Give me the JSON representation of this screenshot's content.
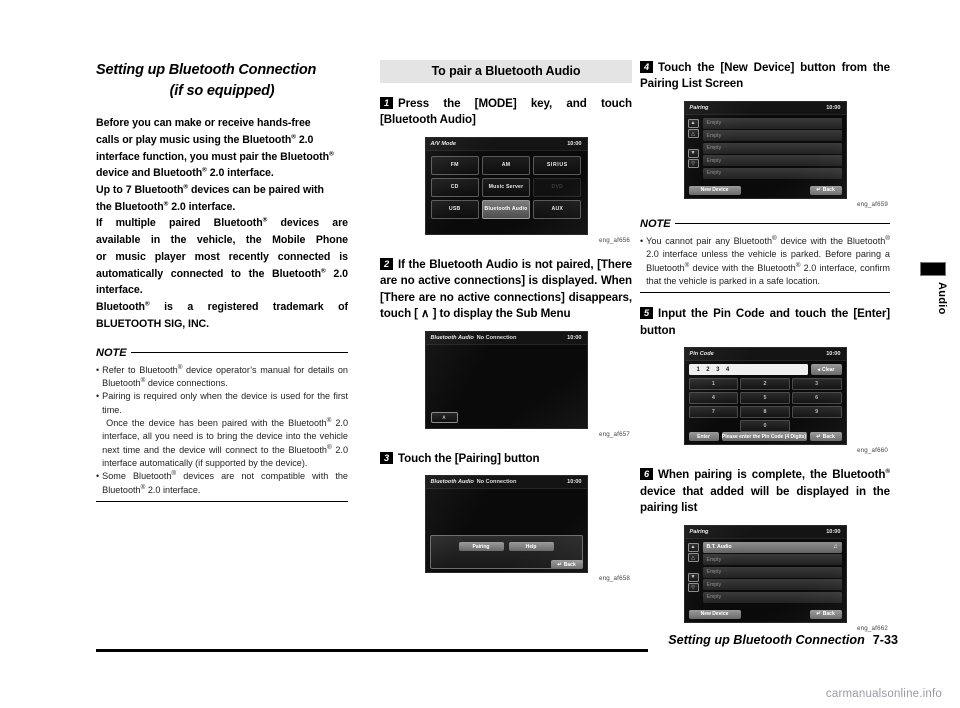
{
  "chapter": {
    "title_line1": "Setting up Bluetooth Connection",
    "title_line2": "(if so equipped)"
  },
  "intro": {
    "lines": [
      "Before you can make or receive hands-free",
      "calls or play music using the Bluetooth® 2.0",
      "interface function, you must pair the Bluetooth®",
      "device and Bluetooth® 2.0 interface.",
      "Up to 7 Bluetooth® devices can be paired with",
      "the Bluetooth® 2.0 interface.",
      "If multiple paired Bluetooth® devices are",
      "available in the vehicle, the Mobile Phone",
      "or music player most recently connected is",
      "automatically connected to the Bluetooth® 2.0",
      "interface.",
      "Bluetooth® is a registered trademark of",
      "BLUETOOTH SIG, INC."
    ]
  },
  "note_left": {
    "label": "NOTE",
    "items": [
      {
        "text": "Refer to Bluetooth® device operator’s manual for details on Bluetooth® device connections.",
        "sub": ""
      },
      {
        "text": "Pairing is required only when the device is used for the first time.",
        "sub": "Once the device has been paired with the Bluetooth® 2.0 interface, all you need is to bring the device into the vehicle next time and the device will connect to the Bluetooth® 2.0 interface automatically (if supported by the device)."
      },
      {
        "text": "Some Bluetooth® devices are not compatible with the Bluetooth® 2.0 interface.",
        "sub": ""
      }
    ]
  },
  "section_band": {
    "title": "To pair a Bluetooth Audio"
  },
  "steps": {
    "s1": {
      "num": "1",
      "text": "Press the [MODE] key, and touch [Bluetooth Audio]",
      "caption": "eng_af656"
    },
    "s2": {
      "num": "2",
      "text": "If the Bluetooth Audio is not paired, [There are no active connections] is displayed. When [There are no active connections] disappears, touch [ ∧ ] to display the Sub Menu",
      "caption": "eng_af657"
    },
    "s3": {
      "num": "3",
      "text": "Touch the [Pairing] button",
      "caption": "eng_af658"
    },
    "s4": {
      "num": "4",
      "text": "Touch the [New Device] button from the Pairing List Screen",
      "caption": "eng_af659"
    },
    "s5": {
      "num": "5",
      "text": "Input the Pin Code and touch the [Enter] button",
      "caption": "eng_af660"
    },
    "s6": {
      "num": "6",
      "text": "When pairing is complete, the Bluetooth® device that added will be displayed in the pairing list",
      "caption": "eng_af662"
    }
  },
  "note_right": {
    "label": "NOTE",
    "text": "You cannot pair any Bluetooth® device with the Bluetooth® 2.0 interface unless the vehicle is parked. Before paring a Bluetooth® device with the Bluetooth® 2.0 interface, confirm that the vehicle is parked in a safe location."
  },
  "screens": {
    "av_mode": {
      "title": "A/V Mode",
      "clock": "10:00",
      "buttons": [
        {
          "label": "FM",
          "state": "normal"
        },
        {
          "label": "AM",
          "state": "normal"
        },
        {
          "label": "SIRIUS",
          "state": "normal"
        },
        {
          "label": "CD",
          "state": "normal"
        },
        {
          "label": "Music Server",
          "state": "normal"
        },
        {
          "label": "DVD",
          "state": "disabled"
        },
        {
          "label": "USB",
          "state": "normal"
        },
        {
          "label": "Bluetooth Audio",
          "state": "selected"
        },
        {
          "label": "AUX",
          "state": "normal"
        }
      ]
    },
    "bt_audio_idle": {
      "title": "Bluetooth Audio",
      "status": "No Connection",
      "clock": "10:00",
      "up_arrow": "∧"
    },
    "bt_audio_submenu": {
      "title": "Bluetooth Audio",
      "status": "No Connection",
      "clock": "10:00",
      "pairing_label": "Pairing",
      "help_label": "Help",
      "back_label": "Back"
    },
    "pairing_empty": {
      "title": "Pairing",
      "clock": "10:00",
      "rows": [
        "Empty",
        "Empty",
        "Empty",
        "Empty",
        "Empty"
      ],
      "new_device_label": "New Device",
      "back_label": "Back",
      "scroll_icons": [
        "▲",
        "△",
        "▼",
        "▽"
      ]
    },
    "pin_code": {
      "title": "Pin Code",
      "clock": "10:00",
      "entered": "1 2 3 4",
      "clear_label": "Clear",
      "keys": [
        "1",
        "2",
        "3",
        "4",
        "5",
        "6",
        "7",
        "8",
        "9",
        "0"
      ],
      "enter_label": "Enter",
      "hint_label": "Please enter the Pin Code (4 Digits)",
      "back_label": "Back"
    },
    "pairing_filled": {
      "title": "Pairing",
      "clock": "10:00",
      "rows": [
        "B.T. Audio",
        "Empty",
        "Empty",
        "Empty",
        "Empty"
      ],
      "device_icon": "♫",
      "new_device_label": "New Device",
      "back_label": "Back",
      "scroll_icons": [
        "▲",
        "△",
        "▼",
        "▽"
      ]
    }
  },
  "side_tab": {
    "label": "Audio"
  },
  "footer": {
    "title": "Setting up Bluetooth Connection",
    "page": "7-33"
  },
  "watermark": {
    "text": "carmanualsonline.info"
  }
}
